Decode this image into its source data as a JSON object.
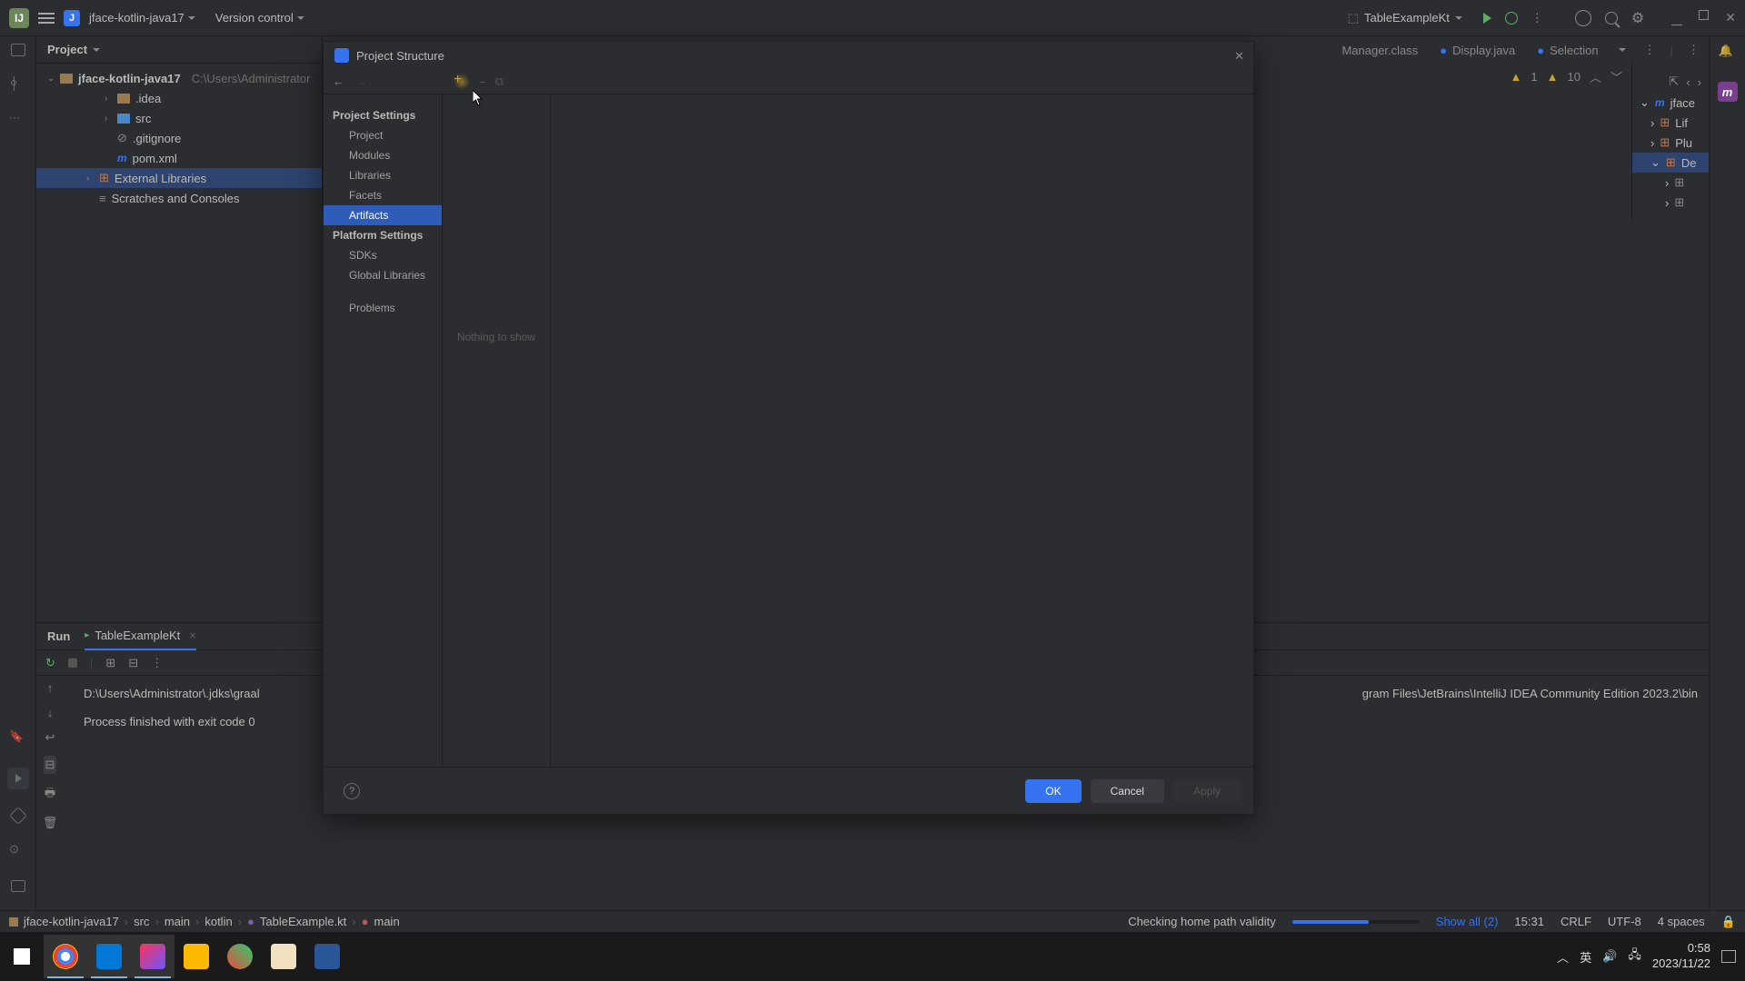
{
  "topbar": {
    "project_name": "jface-kotlin-java17",
    "version_control": "Version control",
    "run_config": "TableExampleKt"
  },
  "project_panel": {
    "title": "Project",
    "root": "jface-kotlin-java17",
    "root_path": "C:\\Users\\Administrator",
    "items": [
      ".idea",
      "src",
      ".gitignore",
      "pom.xml"
    ],
    "external_libs": "External Libraries",
    "scratches": "Scratches and Consoles"
  },
  "tabs": {
    "manager": "Manager.class",
    "display": "Display.java",
    "selection": "Selection"
  },
  "dialog": {
    "title": "Project Structure",
    "section_project": "Project Settings",
    "items_project": [
      "Project",
      "Modules",
      "Libraries",
      "Facets",
      "Artifacts"
    ],
    "section_platform": "Platform Settings",
    "items_platform": [
      "SDKs",
      "Global Libraries"
    ],
    "problems": "Problems",
    "empty": "Nothing to show",
    "ok": "OK",
    "cancel": "Cancel",
    "apply": "Apply"
  },
  "warnings": {
    "w1_count": "1",
    "w2_count": "10"
  },
  "structure": {
    "root": "jface",
    "items": [
      "Lif",
      "Plu",
      "De"
    ]
  },
  "run": {
    "tab_run": "Run",
    "tab_config": "TableExampleKt",
    "line1": "D:\\Users\\Administrator\\.jdks\\graal",
    "line1b": "gram Files\\JetBrains\\IntelliJ IDEA Community Edition 2023.2\\bin",
    "line2": "Process finished with exit code 0"
  },
  "breadcrumb": [
    "jface-kotlin-java17",
    "src",
    "main",
    "kotlin",
    "TableExample.kt",
    "main"
  ],
  "status": {
    "checking": "Checking home path validity",
    "show_all": "Show all (2)",
    "time": "15:31",
    "crlf": "CRLF",
    "encoding": "UTF-8",
    "spaces": "4 spaces"
  },
  "clock": {
    "time": "0:58",
    "date": "2023/11/22"
  }
}
